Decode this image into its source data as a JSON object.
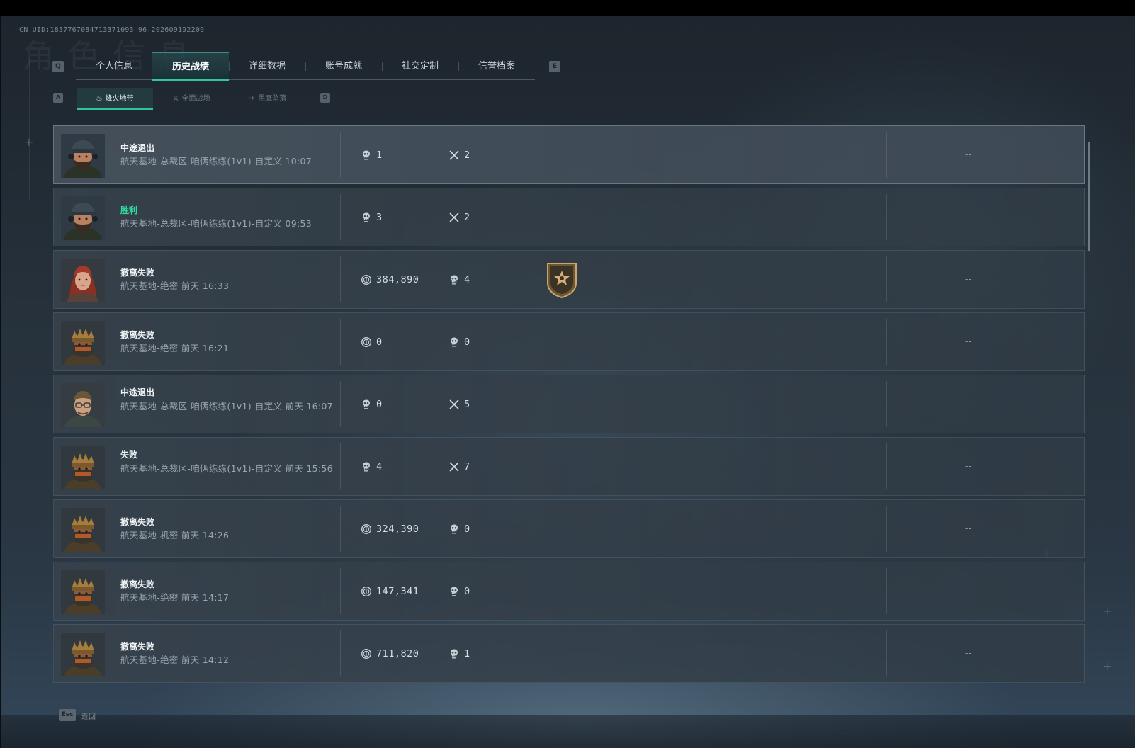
{
  "header": {
    "uid": "CN UID:1837767084713371093 96.202609192209",
    "bg_title": "角色信息"
  },
  "tabs": {
    "left_key": "Q",
    "right_key": "E",
    "items": [
      {
        "label": "个人信息"
      },
      {
        "label": "历史战绩"
      },
      {
        "label": "详细数据"
      },
      {
        "label": "账号成就"
      },
      {
        "label": "社交定制"
      },
      {
        "label": "信誉档案"
      }
    ],
    "active_index": 1
  },
  "subtabs": {
    "left_key": "A",
    "right_key": "D",
    "items": [
      {
        "label": "烽火地带",
        "icon": "campfire-icon"
      },
      {
        "label": "全面战场",
        "icon": "soldier-icon"
      },
      {
        "label": "黑鹰坠落",
        "icon": "helicopter-icon"
      }
    ],
    "active_index": 0
  },
  "records": [
    {
      "result": "中途退出",
      "result_color": "#eef2f4",
      "map": "航天基地-总裁区-咱俩练练(1v1)-自定义 10:07",
      "avatar": "capped-soldier",
      "stat1_icon": "skull-icon",
      "stat1": "1",
      "stat2_icon": "cross-swords-icon",
      "stat2": "2",
      "badge": false,
      "tail": "--"
    },
    {
      "result": "胜利",
      "result_color": "#2fdb9c",
      "map": "航天基地-总裁区-咱俩练练(1v1)-自定义 09:53",
      "avatar": "capped-soldier",
      "stat1_icon": "skull-icon",
      "stat1": "3",
      "stat2_icon": "cross-swords-icon",
      "stat2": "2",
      "badge": false,
      "tail": "--"
    },
    {
      "result": "撤离失败",
      "result_color": "#eef2f4",
      "map": "航天基地-绝密 前天 16:33",
      "avatar": "red-hair-operator",
      "stat1_icon": "coin-icon",
      "stat1": "384,890",
      "stat2_icon": "skull-icon",
      "stat2": "4",
      "badge": true,
      "tail": "--"
    },
    {
      "result": "撤离失败",
      "result_color": "#eef2f4",
      "map": "航天基地-绝密 前天 16:21",
      "avatar": "crowned-operator",
      "stat1_icon": "coin-icon",
      "stat1": "0",
      "stat2_icon": "skull-icon",
      "stat2": "0",
      "badge": false,
      "tail": "--"
    },
    {
      "result": "中途退出",
      "result_color": "#eef2f4",
      "map": "航天基地-总裁区-咱俩练练(1v1)-自定义 前天 16:07",
      "avatar": "glasses-operator",
      "stat1_icon": "skull-icon",
      "stat1": "0",
      "stat2_icon": "cross-swords-icon",
      "stat2": "5",
      "badge": false,
      "tail": "--"
    },
    {
      "result": "失败",
      "result_color": "#eef2f4",
      "map": "航天基地-总裁区-咱俩练练(1v1)-自定义 前天 15:56",
      "avatar": "crowned-operator",
      "stat1_icon": "skull-icon",
      "stat1": "4",
      "stat2_icon": "cross-swords-icon",
      "stat2": "7",
      "badge": false,
      "tail": "--"
    },
    {
      "result": "撤离失败",
      "result_color": "#eef2f4",
      "map": "航天基地-机密 前天 14:26",
      "avatar": "crowned-operator",
      "stat1_icon": "coin-icon",
      "stat1": "324,390",
      "stat2_icon": "skull-icon",
      "stat2": "0",
      "badge": false,
      "tail": "--"
    },
    {
      "result": "撤离失败",
      "result_color": "#eef2f4",
      "map": "航天基地-绝密 前天 14:17",
      "avatar": "crowned-operator",
      "stat1_icon": "coin-icon",
      "stat1": "147,341",
      "stat2_icon": "skull-icon",
      "stat2": "0",
      "badge": false,
      "tail": "--"
    },
    {
      "result": "撤离失败",
      "result_color": "#eef2f4",
      "map": "航天基地-绝密 前天 14:12",
      "avatar": "crowned-operator",
      "stat1_icon": "coin-icon",
      "stat1": "711,820",
      "stat2_icon": "skull-icon",
      "stat2": "1",
      "badge": false,
      "tail": "--"
    }
  ],
  "footer": {
    "esc_key": "Esc",
    "back_label": "返回"
  }
}
